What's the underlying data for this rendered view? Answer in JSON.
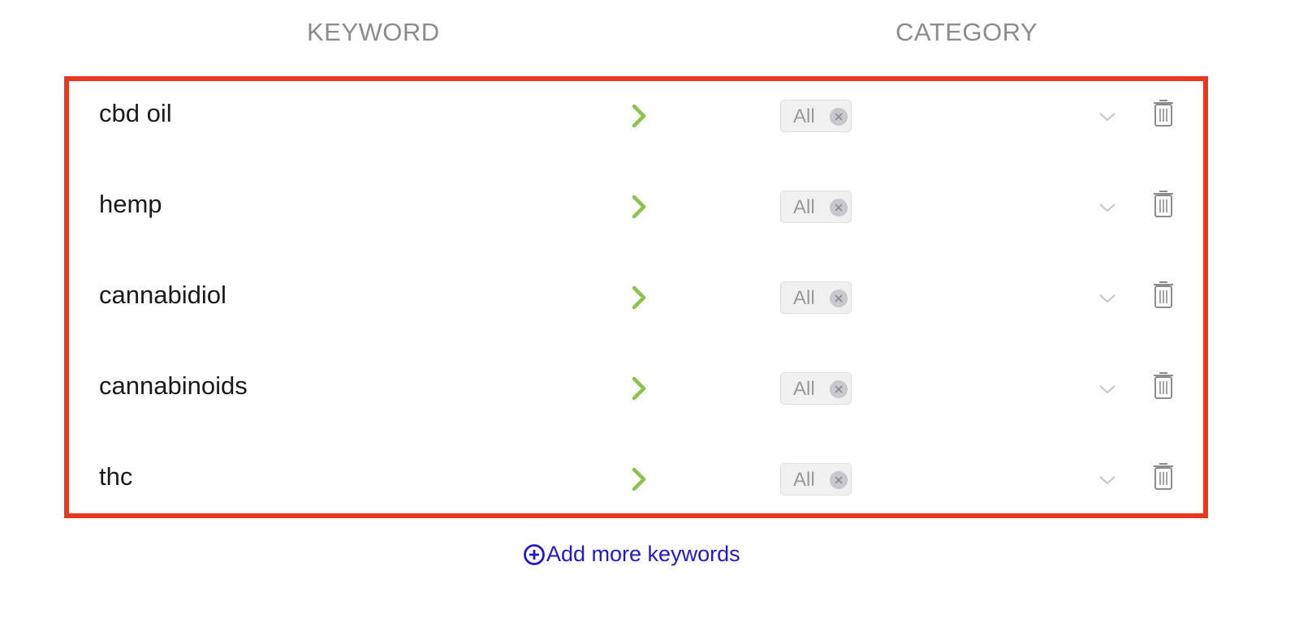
{
  "headers": {
    "keyword": "KEYWORD",
    "category": "CATEGORY"
  },
  "rows": [
    {
      "keyword": "cbd oil",
      "category_chip": "All"
    },
    {
      "keyword": "hemp",
      "category_chip": "All"
    },
    {
      "keyword": "cannabidiol",
      "category_chip": "All"
    },
    {
      "keyword": "cannabinoids",
      "category_chip": "All"
    },
    {
      "keyword": "thc",
      "category_chip": "All"
    }
  ],
  "add_more_label": "Add more keywords",
  "colors": {
    "highlight_border": "#e8381f",
    "arrow": "#8bc34a",
    "link": "#2219c8",
    "header_text": "#8c8c8c"
  },
  "icons": {
    "row_arrow": "chevron-right-icon",
    "chip_remove": "close-circle-icon",
    "dropdown": "chevron-down-icon",
    "delete": "trash-icon",
    "add": "plus-circle-icon"
  }
}
